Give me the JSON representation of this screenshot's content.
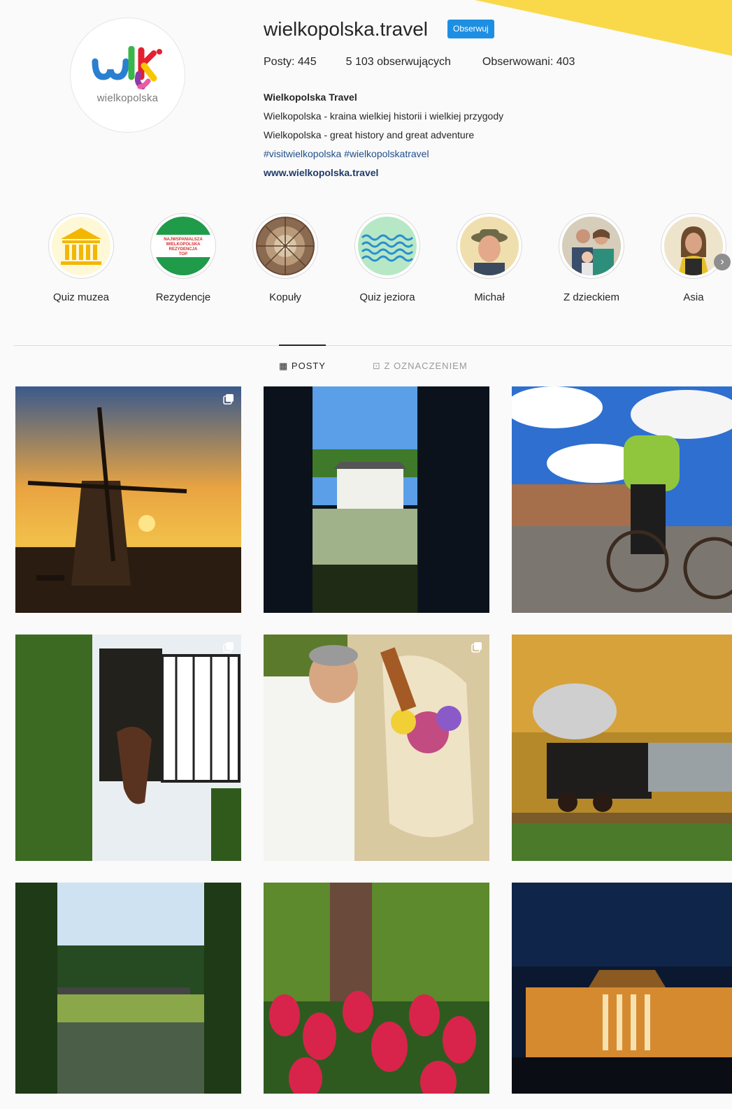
{
  "profile": {
    "avatar_caption": "wielkopolska",
    "username": "wielkopolska.travel",
    "follow_label": "Obserwuj",
    "stats": {
      "posts": "Posty: 445",
      "followers": "5 103 obserwujących",
      "following": "Obserwowani: 403"
    },
    "bio": {
      "name": "Wielkopolska Travel",
      "line1": "Wielkopolska - kraina wielkiej historii i wielkiej przygody",
      "line2": "Wielkopolska - great history and great adventure",
      "tags": "#visitwielkopolska #wielkopolskatravel",
      "link": "www.wielkopolska.travel"
    }
  },
  "highlights": [
    {
      "label": "Quiz muzea",
      "icon": "museum-icon"
    },
    {
      "label": "Rezydencje",
      "icon": "residence-badge-icon",
      "badge_text": "NAJWSPANIALSZA WIELKOPOLSKA REZYDENCJA TOP"
    },
    {
      "label": "Kopuły",
      "icon": "dome-icon"
    },
    {
      "label": "Quiz jeziora",
      "icon": "waves-icon"
    },
    {
      "label": "Michał",
      "icon": "person-photo"
    },
    {
      "label": "Z dzieckiem",
      "icon": "family-photo"
    },
    {
      "label": "Asia",
      "icon": "person-photo"
    }
  ],
  "tabs": {
    "posts": "POSTY",
    "tagged": "Z OZNACZENIEM"
  },
  "posts": [
    {
      "subject": "windmill at sunset",
      "multi": true
    },
    {
      "subject": "palace framed by columns"
    },
    {
      "subject": "cyclist on market square"
    },
    {
      "subject": "horse in stable window",
      "multi": true
    },
    {
      "subject": "man with decorated ox",
      "multi": true
    },
    {
      "subject": "steam train in autumn"
    },
    {
      "subject": "train by the lake"
    },
    {
      "subject": "red tulips"
    },
    {
      "subject": "palace at night"
    }
  ]
}
